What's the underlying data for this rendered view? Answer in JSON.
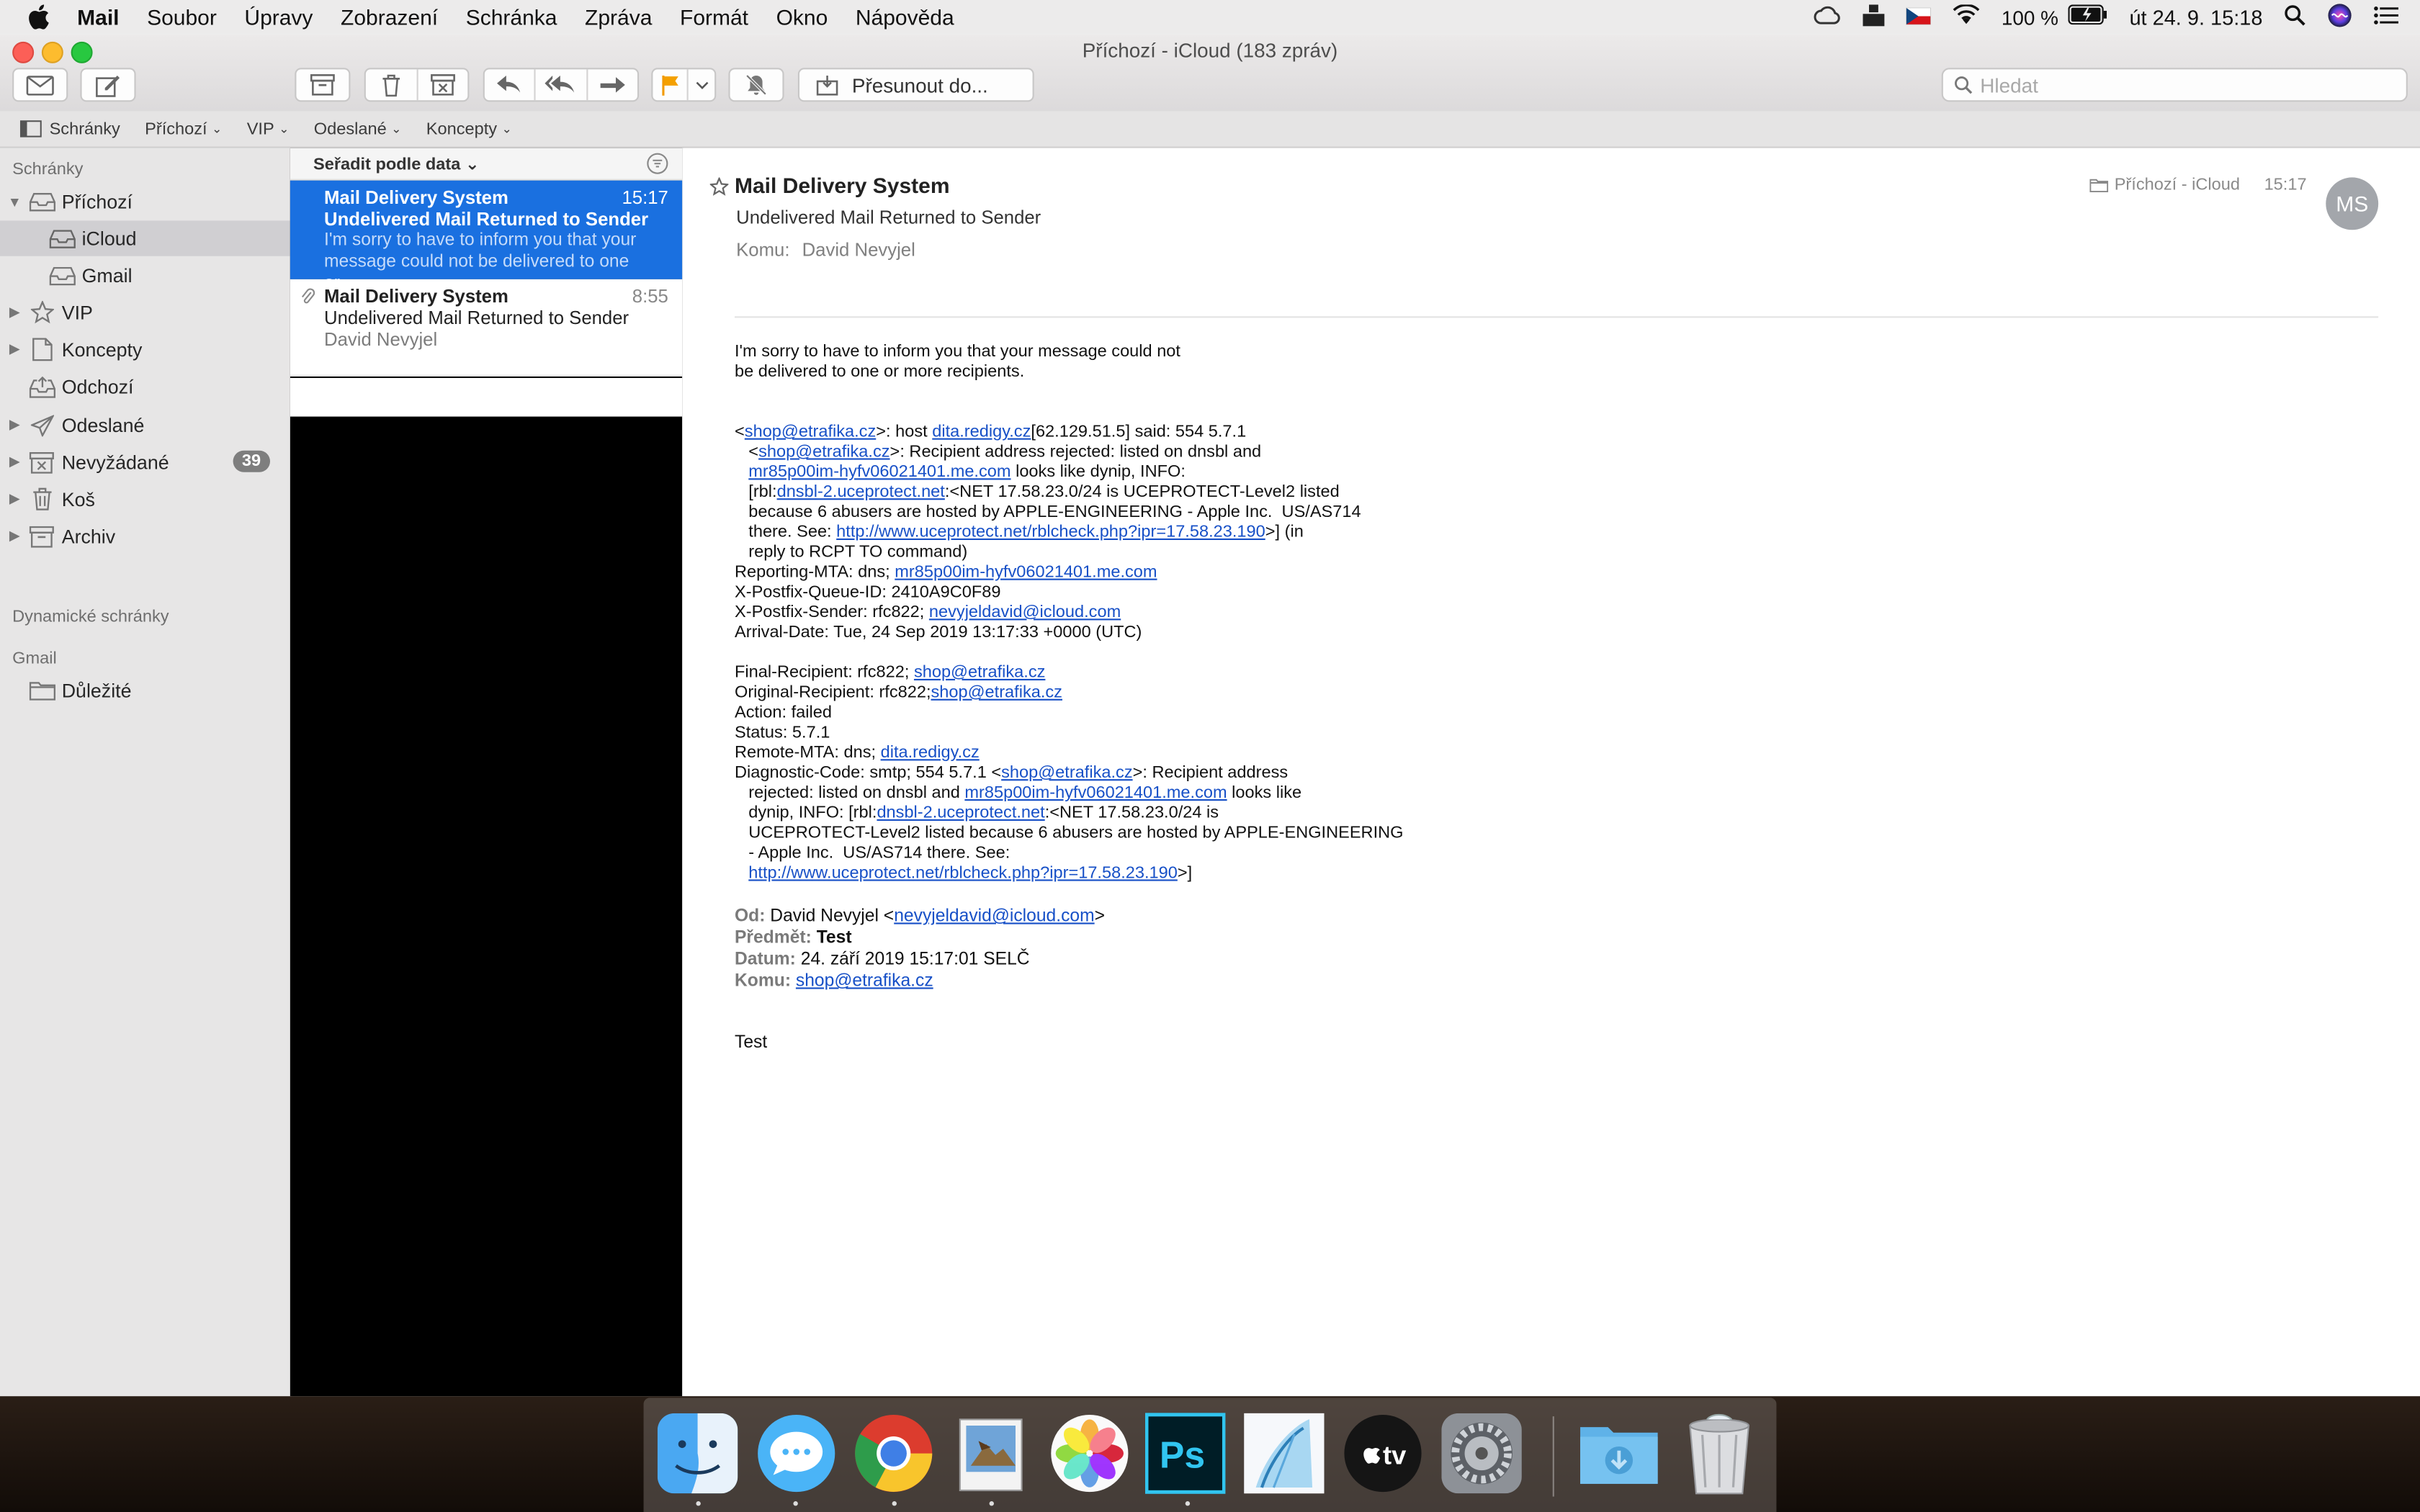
{
  "menubar": {
    "items": [
      "Mail",
      "Soubor",
      "Úpravy",
      "Zobrazení",
      "Schránka",
      "Zpráva",
      "Formát",
      "Okno",
      "Nápověda"
    ],
    "battery": "100 %",
    "datetime": "út 24. 9.  15:18"
  },
  "window": {
    "title": "Příchozí - iCloud (183 zpráv)",
    "move_label": "Přesunout do...",
    "search_placeholder": "Hledat"
  },
  "favorites": [
    {
      "label": "Schránky",
      "caret": false
    },
    {
      "label": "Příchozí",
      "caret": true
    },
    {
      "label": "VIP",
      "caret": true
    },
    {
      "label": "Odeslané",
      "caret": true
    },
    {
      "label": "Koncepty",
      "caret": true
    }
  ],
  "sidebar": {
    "header": "Schránky",
    "items": [
      {
        "label": "Příchozí",
        "icon": "inbox-icon",
        "tri": "▼"
      },
      {
        "label": "iCloud",
        "icon": "inbox-icon",
        "tri": ""
      },
      {
        "label": "Gmail",
        "icon": "inbox-icon",
        "tri": ""
      },
      {
        "label": "VIP",
        "icon": "star-icon",
        "tri": "▶"
      },
      {
        "label": "Koncepty",
        "icon": "document-icon",
        "tri": "▶"
      },
      {
        "label": "Odchozí",
        "icon": "outbox-icon",
        "tri": ""
      },
      {
        "label": "Odeslané",
        "icon": "paper-plane-icon",
        "tri": "▶"
      },
      {
        "label": "Nevyžádané",
        "icon": "junk-icon",
        "tri": "▶",
        "badge": "39"
      },
      {
        "label": "Koš",
        "icon": "trash-icon",
        "tri": "▶"
      },
      {
        "label": "Archiv",
        "icon": "archive-icon",
        "tri": "▶"
      }
    ],
    "dynamic_header": "Dynamické schránky",
    "gmail_header": "Gmail",
    "gmail_items": [
      {
        "label": "Důležité",
        "icon": "folder-icon"
      }
    ]
  },
  "list": {
    "sort_label": "Seřadit podle data",
    "messages": [
      {
        "from": "Mail Delivery System",
        "time": "15:17",
        "subject": "Undelivered Mail Returned to Sender",
        "preview": "I'm sorry to have to inform you that your message could not be delivered to one or…",
        "selected": true
      },
      {
        "from": "Mail Delivery System",
        "time": "8:55",
        "subject": "Undelivered Mail Returned to Sender",
        "preview": "David Nevyjel",
        "selected": false
      }
    ]
  },
  "reader": {
    "from": "Mail Delivery System",
    "subject": "Undelivered Mail Returned to Sender",
    "to_label": "Komu:",
    "to_value": "David Nevyjel",
    "mailbox": "Příchozí - iCloud",
    "time": "15:17",
    "avatar": "MS",
    "body": {
      "intro_1": "I'm sorry to have to inform you that your message could not",
      "intro_2": "be delivered to one or more recipients.",
      "r1_a": "<",
      "r1_link1": "shop@etrafika.cz",
      "r1_b": ">: host ",
      "r1_link2": "dita.redigy.cz",
      "r1_c": "[62.129.51.5] said: 554 5.7.1",
      "r2_a": "<",
      "r2_link": "shop@etrafika.cz",
      "r2_b": ">: Recipient address rejected: listed on dnsbl and",
      "r3_link": "mr85p00im-hyfv06021401.me.com",
      "r3_b": " looks like dynip, INFO:",
      "r4_a": "[rbl:",
      "r4_link": "dnsbl-2.uceprotect.net",
      "r4_b": ":<NET 17.58.23.0/24 is UCEPROTECT-Level2 listed",
      "r5": "because 6 abusers are hosted by APPLE-ENGINEERING - Apple Inc.  US/AS714",
      "r6_a": "there. See: ",
      "r6_link": "http://www.uceprotect.net/rblcheck.php?ipr=17.58.23.190",
      "r6_b": ">] (in",
      "r7": "reply to RCPT TO command)",
      "r8_a": "Reporting-MTA: dns; ",
      "r8_link": "mr85p00im-hyfv06021401.me.com",
      "r9": "X-Postfix-Queue-ID: 2410A9C0F89",
      "r10_a": "X-Postfix-Sender: rfc822; ",
      "r10_link": "nevyjeldavid@icloud.com",
      "r11": "Arrival-Date: Tue, 24 Sep 2019 13:17:33 +0000 (UTC)",
      "s1_a": "Final-Recipient: rfc822; ",
      "s1_link": "shop@etrafika.cz",
      "s2_a": "Original-Recipient: rfc822;",
      "s2_link": "shop@etrafika.cz",
      "s3": "Action: failed",
      "s4": "Status: 5.7.1",
      "s5_a": "Remote-MTA: dns; ",
      "s5_link": "dita.redigy.cz",
      "s6_a": "Diagnostic-Code: smtp; 554 5.7.1 <",
      "s6_link": "shop@etrafika.cz",
      "s6_b": ">: Recipient address",
      "s7_a": "rejected: listed on dnsbl and ",
      "s7_link": "mr85p00im-hyfv06021401.me.com",
      "s7_b": " looks like",
      "s8_a": "dynip, INFO: [rbl:",
      "s8_link": "dnsbl-2.uceprotect.net",
      "s8_b": ":<NET 17.58.23.0/24 is",
      "s9": "UCEPROTECT-Level2 listed because 6 abusers are hosted by APPLE-ENGINEERING",
      "s10": "- Apple Inc.  US/AS714 there. See:",
      "s11_link": "http://www.uceprotect.net/rblcheck.php?ipr=17.58.23.190",
      "s11_b": ">]",
      "h1_label": "Od:",
      "h1_a": " David Nevyjel <",
      "h1_link": "nevyjeldavid@icloud.com",
      "h1_b": ">",
      "h2_label": "Předmět:",
      "h2_val": " Test",
      "h3_label": "Datum:",
      "h3_val": " 24. září 2019 15:17:01 SELČ",
      "h4_label": "Komu:",
      "h4_link": "shop@etrafika.cz",
      "final": "Test"
    }
  },
  "dock": [
    "Finder",
    "Messages",
    "Chrome",
    "Preview",
    "Photos",
    "Photoshop",
    "Archicad",
    "Apple TV",
    "System Preferences",
    "Downloads",
    "Trash"
  ],
  "colors": {
    "accent": "#1a70e0",
    "link": "#1750c7",
    "sidebar": "#e7e6e6",
    "selection": "#d0cfd2"
  }
}
